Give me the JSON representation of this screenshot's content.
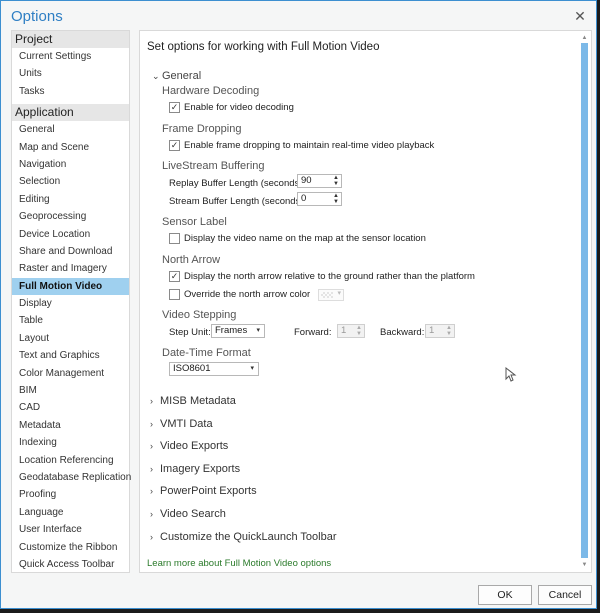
{
  "window": {
    "title": "Options",
    "close_icon": "close-icon"
  },
  "sidebar": {
    "groups": [
      {
        "header": "Project",
        "items": [
          "Current Settings",
          "Units",
          "Tasks"
        ]
      },
      {
        "header": "Application",
        "items": [
          "General",
          "Map and Scene",
          "Navigation",
          "Selection",
          "Editing",
          "Geoprocessing",
          "Device Location",
          "Share and Download",
          "Raster and Imagery",
          "Full Motion Video",
          "Display",
          "Table",
          "Layout",
          "Text and Graphics",
          "Color Management",
          "BIM",
          "CAD",
          "Metadata",
          "Indexing",
          "Location Referencing",
          "Geodatabase Replication",
          "Proofing",
          "Language",
          "User Interface",
          "Customize the Ribbon",
          "Quick Access Toolbar"
        ]
      }
    ],
    "selected": "Full Motion Video"
  },
  "main": {
    "heading": "Set options for working with Full Motion Video",
    "general": {
      "label": "General",
      "expanded": true,
      "hardware_decoding": {
        "title": "Hardware Decoding",
        "enable_label": "Enable for video decoding",
        "enable_checked": true
      },
      "frame_dropping": {
        "title": "Frame Dropping",
        "enable_label": "Enable frame dropping to maintain real-time video playback",
        "enable_checked": true
      },
      "livestream": {
        "title": "LiveStream Buffering",
        "replay_label": "Replay Buffer Length (seconds)",
        "replay_value": "90",
        "stream_label": "Stream Buffer Length (seconds)",
        "stream_value": "0"
      },
      "sensor_label": {
        "title": "Sensor Label",
        "display_label": "Display the video name on the map at the sensor location",
        "display_checked": false
      },
      "north_arrow": {
        "title": "North Arrow",
        "relative_label": "Display the north arrow relative to the ground rather than the platform",
        "relative_checked": true,
        "override_label": "Override the north arrow color",
        "override_checked": false
      },
      "video_stepping": {
        "title": "Video Stepping",
        "step_unit_label": "Step Unit:",
        "step_unit_value": "Frames",
        "forward_label": "Forward:",
        "forward_value": "1",
        "backward_label": "Backward:",
        "backward_value": "1"
      },
      "date_time": {
        "title": "Date-Time Format",
        "value": "ISO8601"
      }
    },
    "collapsed_sections": [
      "MISB Metadata",
      "VMTI Data",
      "Video Exports",
      "Imagery Exports",
      "PowerPoint Exports",
      "Video Search",
      "Customize the QuickLaunch Toolbar"
    ],
    "learn_more": "Learn more about Full Motion Video options"
  },
  "buttons": {
    "ok": "OK",
    "cancel": "Cancel"
  },
  "colors": {
    "accent": "#2f7fc4",
    "selection": "#9fd0ef",
    "scroll_thumb": "#7cb9e8",
    "link": "#2a7a2a"
  }
}
